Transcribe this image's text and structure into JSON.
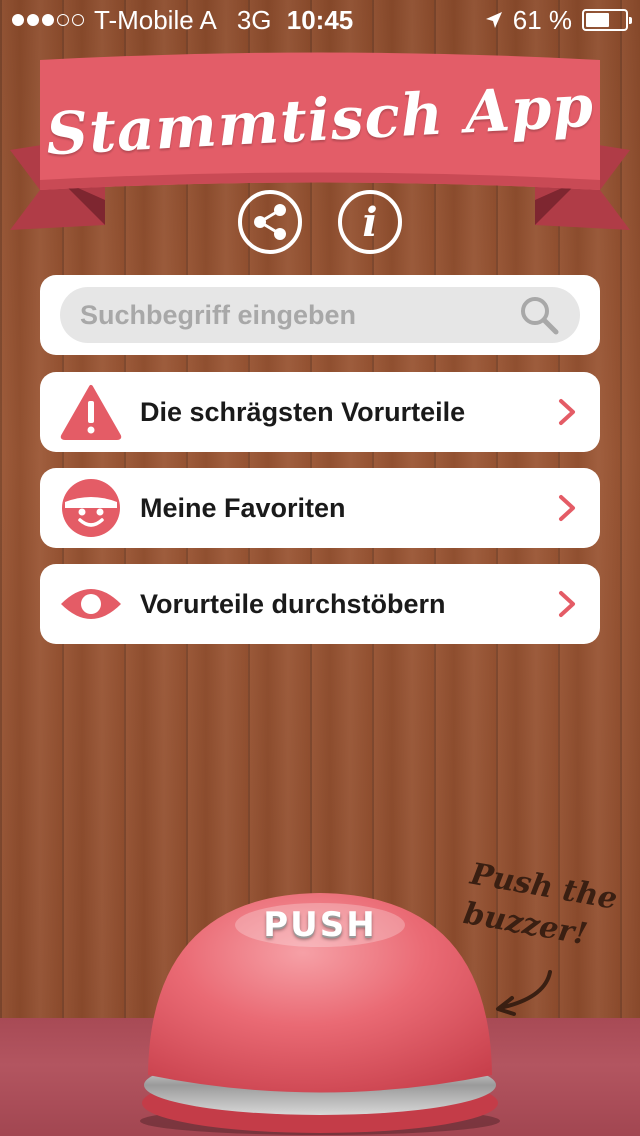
{
  "status_bar": {
    "carrier": "T-Mobile A",
    "network": "3G",
    "time": "10:45",
    "battery": "61 %",
    "battery_level": 0.61,
    "signal_bars_filled": 3,
    "signal_bars_total": 5,
    "icons": [
      "location-arrow-icon",
      "battery-icon"
    ]
  },
  "app": {
    "title": "Stammtisch App"
  },
  "header_actions": {
    "share_icon": "share-icon",
    "info_icon": "info-icon",
    "info_glyph": "i"
  },
  "search": {
    "placeholder": "Suchbegriff eingeben",
    "value": "",
    "icon": "search-icon"
  },
  "menu": {
    "items": [
      {
        "label": "Die schrägsten Vorurteile",
        "icon": "warning-icon"
      },
      {
        "label": "Meine Favoriten",
        "icon": "smiley-face-icon"
      },
      {
        "label": "Vorurteile durchstöbern",
        "icon": "eye-icon"
      }
    ]
  },
  "buzzer": {
    "label": "PUSH",
    "hint": "Push the buzzer!"
  },
  "colors": {
    "accent": "#e45c66",
    "banner": "#e35d68",
    "banner_shadow": "#b03c47",
    "wood": "#9b5634",
    "bottom_band": "#b35560"
  }
}
